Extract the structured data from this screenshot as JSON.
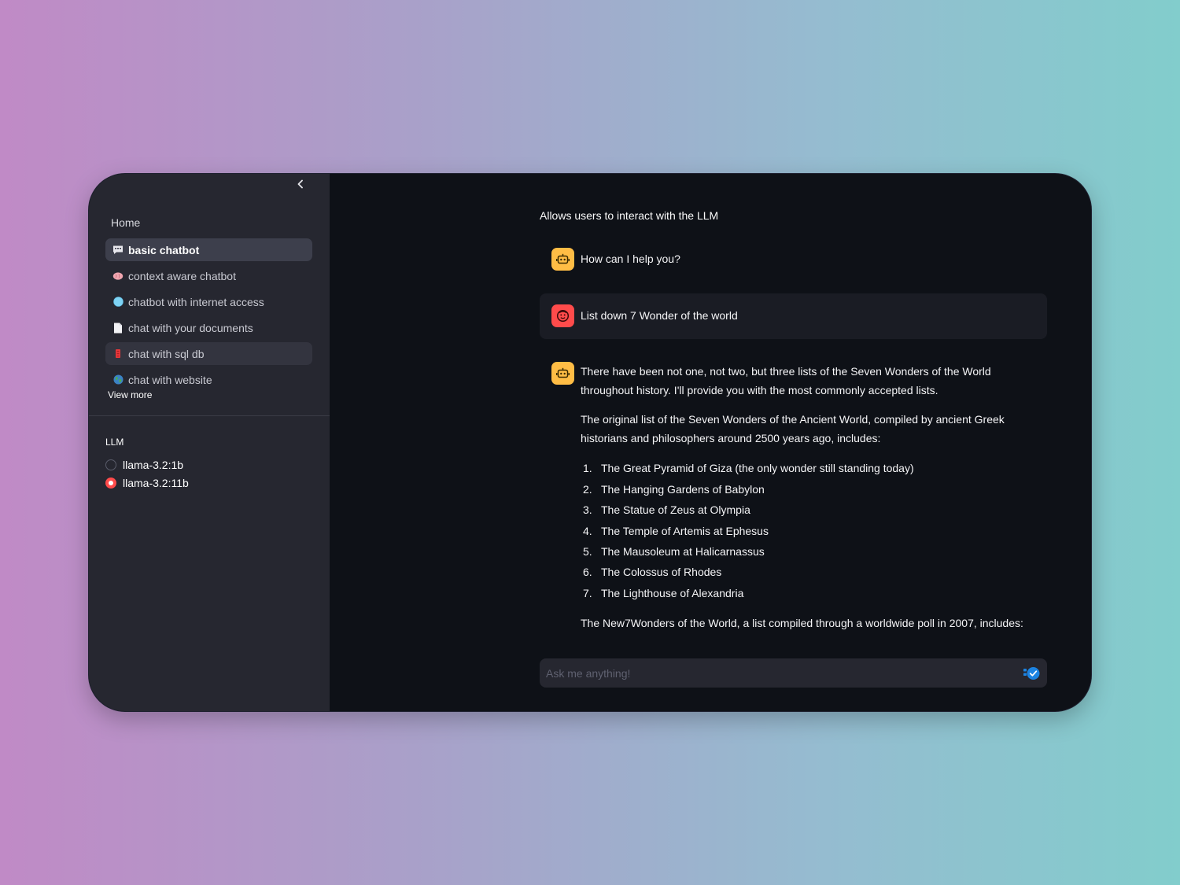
{
  "sidebar": {
    "home_label": "Home",
    "items": [
      {
        "label": "basic chatbot",
        "icon": "speech-bubble-icon"
      },
      {
        "label": "context aware chatbot",
        "icon": "brain-icon"
      },
      {
        "label": "chatbot with internet access",
        "icon": "globe-icon"
      },
      {
        "label": "chat with your documents",
        "icon": "document-icon"
      },
      {
        "label": "chat with sql db",
        "icon": "database-icon"
      },
      {
        "label": "chat with website",
        "icon": "web-globe-icon"
      }
    ],
    "view_more": "View more",
    "llm_label": "LLM",
    "llm_options": [
      "llama-3.2:1b",
      "llama-3.2:11b"
    ],
    "llm_selected": "llama-3.2:11b"
  },
  "main": {
    "caption": "Allows users to interact with the LLM",
    "messages": [
      {
        "role": "assistant",
        "text": "How can I help you?"
      },
      {
        "role": "user",
        "text": "List down 7 Wonder of the world"
      },
      {
        "role": "assistant",
        "intro": "There have been not one, not two, but three lists of the Seven Wonders of the World throughout history. I'll provide you with the most commonly accepted lists.",
        "paragraph2": "The original list of the Seven Wonders of the Ancient World, compiled by ancient Greek historians and philosophers around 2500 years ago, includes:",
        "list": [
          {
            "n": "1.",
            "text": "The Great Pyramid of Giza (the only wonder still standing today)"
          },
          {
            "n": "2.",
            "text": "The Hanging Gardens of Babylon"
          },
          {
            "n": "3.",
            "text": "The Statue of Zeus at Olympia"
          },
          {
            "n": "4.",
            "text": "The Temple of Artemis at Ephesus"
          },
          {
            "n": "5.",
            "text": "The Mausoleum at Halicarnassus"
          },
          {
            "n": "6.",
            "text": "The Colossus of Rhodes"
          },
          {
            "n": "7.",
            "text": "The Lighthouse of Alexandria"
          }
        ],
        "paragraph3": "The New7Wonders of the World, a list compiled through a worldwide poll in 2007, includes:"
      }
    ],
    "input_placeholder": "Ask me anything!"
  },
  "colors": {
    "accent": "#ff4b4b",
    "bot_avatar": "#ffbd45",
    "send": "#1c83e1",
    "sidebar_bg": "#262730",
    "main_bg": "#0e1117"
  }
}
